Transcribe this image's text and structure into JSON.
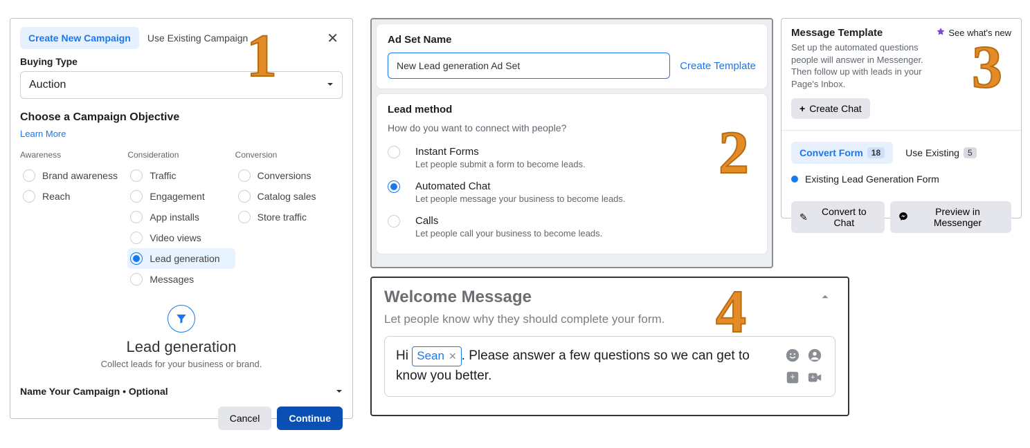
{
  "panel1": {
    "tabs": {
      "create": "Create New Campaign",
      "existing": "Use Existing Campaign"
    },
    "buying_type_label": "Buying Type",
    "buying_type_value": "Auction",
    "objective_title": "Choose a Campaign Objective",
    "learn_more": "Learn More",
    "cols": {
      "awareness": {
        "head": "Awareness",
        "items": [
          "Brand awareness",
          "Reach"
        ]
      },
      "consideration": {
        "head": "Consideration",
        "items": [
          "Traffic",
          "Engagement",
          "App installs",
          "Video views",
          "Lead generation",
          "Messages"
        ],
        "selected_index": 4
      },
      "conversion": {
        "head": "Conversion",
        "items": [
          "Conversions",
          "Catalog sales",
          "Store traffic"
        ]
      }
    },
    "selected_obj": {
      "title": "Lead generation",
      "sub": "Collect leads for your business or brand."
    },
    "name_campaign": "Name Your Campaign • Optional",
    "footer": {
      "cancel": "Cancel",
      "continue": "Continue"
    }
  },
  "panel2": {
    "adset_name_label": "Ad Set Name",
    "adset_name_value": "New Lead generation Ad Set",
    "create_template": "Create Template",
    "lead_method": {
      "title": "Lead method",
      "sub": "How do you want to connect with people?"
    },
    "methods": [
      {
        "title": "Instant Forms",
        "sub": "Let people submit a form to become leads.",
        "selected": false
      },
      {
        "title": "Automated Chat",
        "sub": "Let people message your business to become leads.",
        "selected": true
      },
      {
        "title": "Calls",
        "sub": "Let people call your business to become leads.",
        "selected": false
      }
    ]
  },
  "panel3": {
    "title": "Message Template",
    "sub": "Set up the automated questions people will answer in Messenger. Then follow up with leads in your Page's Inbox.",
    "whats_new": "See what's new",
    "create_chat": "Create Chat",
    "tabs": {
      "convert": {
        "label": "Convert Form",
        "count": "18"
      },
      "existing": {
        "label": "Use Existing",
        "count": "5"
      }
    },
    "form_row": "Existing Lead Generation Form",
    "actions": {
      "convert": "Convert to Chat",
      "preview": "Preview in Messenger"
    }
  },
  "panel4": {
    "title": "Welcome Message",
    "sub": "Let people know why they should complete your form.",
    "greeting_pre": "Hi ",
    "tag": "Sean",
    "greeting_post": ". Please answer a few questions so we can get to know you better."
  },
  "nums": {
    "n1": "1",
    "n2": "2",
    "n3": "3",
    "n4": "4"
  }
}
